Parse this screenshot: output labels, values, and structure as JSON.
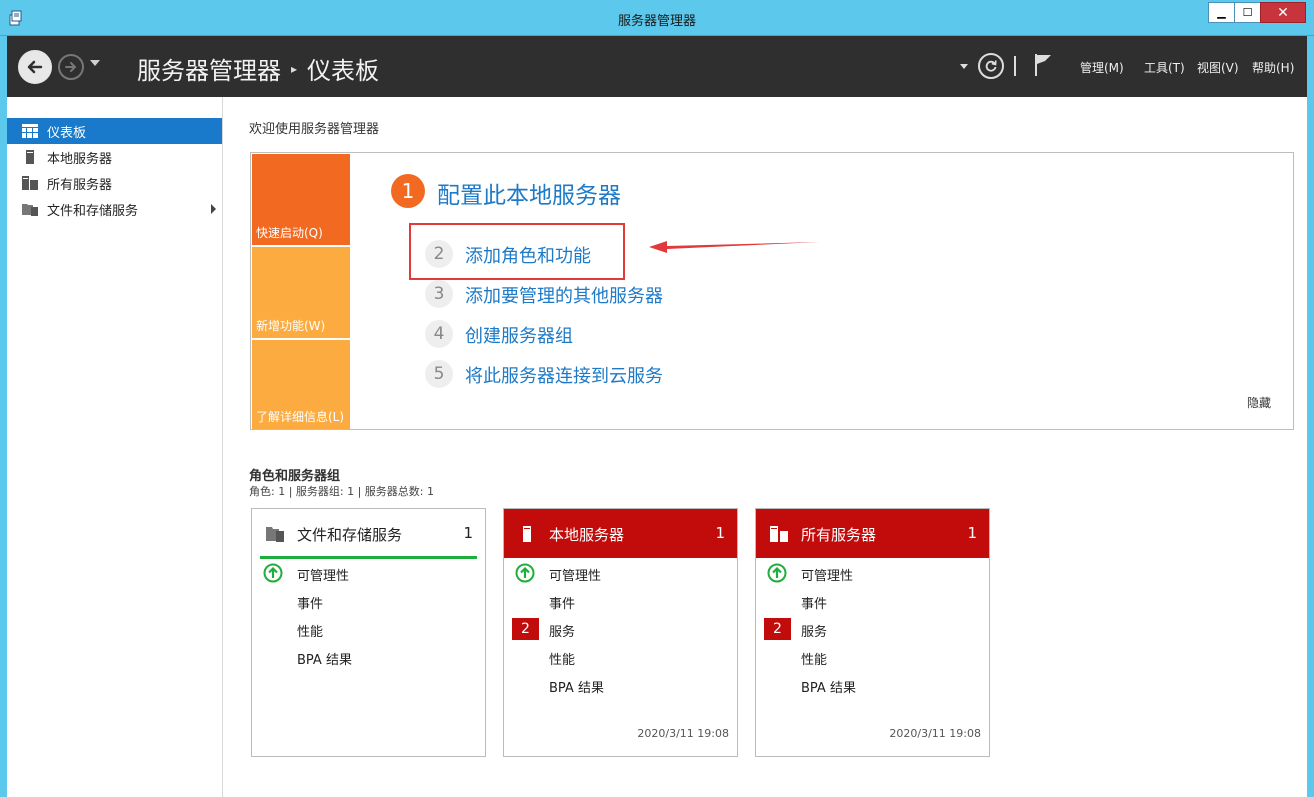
{
  "window": {
    "title": "服务器管理器",
    "minimize": "▁",
    "maximize": "☐",
    "close": "✕"
  },
  "header": {
    "breadcrumb_root": "服务器管理器",
    "breadcrumb_separator": "▸",
    "breadcrumb_current": "仪表板",
    "menus": [
      "管理(M)",
      "工具(T)",
      "视图(V)",
      "帮助(H)"
    ]
  },
  "sidebar": {
    "items": [
      {
        "label": "仪表板",
        "icon": "dashboard-icon",
        "active": true
      },
      {
        "label": "本地服务器",
        "icon": "server-icon",
        "active": false
      },
      {
        "label": "所有服务器",
        "icon": "servers-icon",
        "active": false
      },
      {
        "label": "文件和存储服务",
        "icon": "storage-icon",
        "active": false,
        "expandable": true
      }
    ]
  },
  "welcome": {
    "title": "欢迎使用服务器管理器",
    "tiles": [
      "快速启动(Q)",
      "新增功能(W)",
      "了解详细信息(L)"
    ],
    "step1": {
      "num": "1",
      "label": "配置此本地服务器"
    },
    "steps": [
      {
        "num": "2",
        "label": "添加角色和功能"
      },
      {
        "num": "3",
        "label": "添加要管理的其他服务器"
      },
      {
        "num": "4",
        "label": "创建服务器组"
      },
      {
        "num": "5",
        "label": "将此服务器连接到云服务"
      }
    ],
    "hide": "隐藏"
  },
  "roles": {
    "title": "角色和服务器组",
    "subtitle": "角色: 1 | 服务器组: 1 | 服务器总数: 1",
    "cards": [
      {
        "title": "文件和存储服务",
        "count": "1",
        "rows": [
          "可管理性",
          "事件",
          "性能",
          "BPA 结果"
        ],
        "timestamp": ""
      },
      {
        "title": "本地服务器",
        "count": "1",
        "rows": [
          "可管理性",
          "事件",
          "服务",
          "性能",
          "BPA 结果"
        ],
        "badge": "2",
        "timestamp": "2020/3/11 19:08"
      },
      {
        "title": "所有服务器",
        "count": "1",
        "rows": [
          "可管理性",
          "事件",
          "服务",
          "性能",
          "BPA 结果"
        ],
        "badge": "2",
        "timestamp": "2020/3/11 19:08"
      }
    ]
  },
  "colors": {
    "titlebar": "#5cc8ec",
    "header": "#2f2f2f",
    "accent": "#1979ca",
    "orange": "#f26a21",
    "light_orange": "#fbab3f",
    "alert_red": "#c20b0b",
    "ok_green": "#1fae3c",
    "annotation_red": "#e03a3a"
  }
}
